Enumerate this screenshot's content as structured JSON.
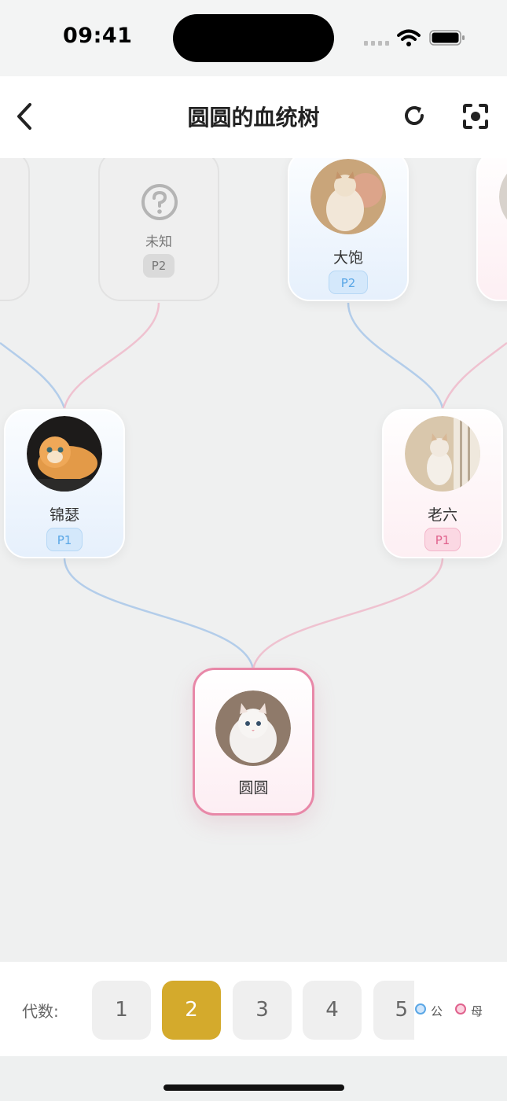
{
  "status_bar": {
    "time": "09:41"
  },
  "nav": {
    "title": "圆圆的血统树"
  },
  "tree": {
    "unknown_parent": {
      "name": "未知",
      "badge": "P2"
    },
    "grandfather": {
      "name": "大饱",
      "badge": "P2",
      "gender": "male"
    },
    "father": {
      "name": "锦瑟",
      "badge": "P1",
      "gender": "male"
    },
    "mother": {
      "name": "老六",
      "badge": "P1",
      "gender": "female"
    },
    "self": {
      "name": "圆圆",
      "gender": "female"
    }
  },
  "bottom_bar": {
    "label": "代数:",
    "generations": [
      "1",
      "2",
      "3",
      "4",
      "5"
    ],
    "selected_generation": "2",
    "legend": [
      {
        "label": "公",
        "color": "#5aa7e6"
      },
      {
        "label": "母",
        "color": "#e0628d"
      }
    ]
  },
  "colors": {
    "male_line": "#b3cdea",
    "female_line": "#efc2d0",
    "accent": "#d4aa2c",
    "self_border": "#e888a8"
  }
}
